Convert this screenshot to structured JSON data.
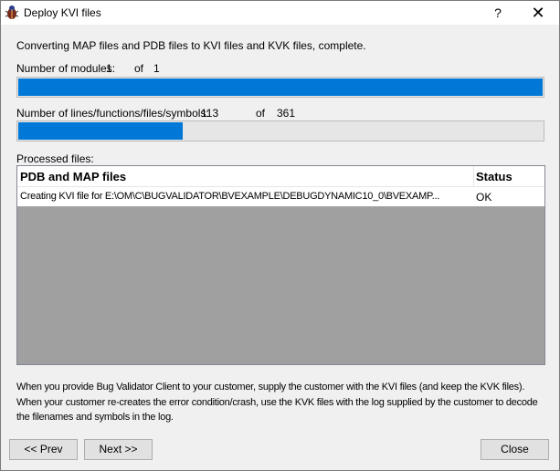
{
  "window": {
    "title": "Deploy KVI files",
    "help_label": "?",
    "close_label": "✕"
  },
  "status_text": "Converting MAP files and PDB files to KVI files and KVK files,  complete.",
  "modules": {
    "label": "Number of modules:",
    "current": "1",
    "of_label": "of",
    "total": "1",
    "progress_fraction": 1.0
  },
  "symbols": {
    "label": "Number of lines/functions/files/symbols:",
    "current": "113",
    "of_label": "of",
    "total": "361",
    "progress_fraction": 0.313
  },
  "processed_label": "Processed files:",
  "list": {
    "columns": [
      "PDB and MAP files",
      "Status"
    ],
    "rows": [
      {
        "file": "Creating KVI file for E:\\OM\\C\\BUGVALIDATOR\\BVEXAMPLE\\DEBUGDYNAMIC10_0\\BVEXAMP...",
        "status": "OK"
      }
    ]
  },
  "info_lines": [
    "When you provide Bug Validator Client to your customer, supply the customer with the KVI files (and keep the KVK files).",
    "When your customer re-creates the error condition/crash, use the KVK files with the log supplied by the customer to decode",
    "the filenames and symbols in the log."
  ],
  "buttons": {
    "prev": "<< Prev",
    "next": "Next >>",
    "close": "Close"
  },
  "colors": {
    "progress": "#0078d7",
    "list_empty": "#a0a0a0"
  }
}
